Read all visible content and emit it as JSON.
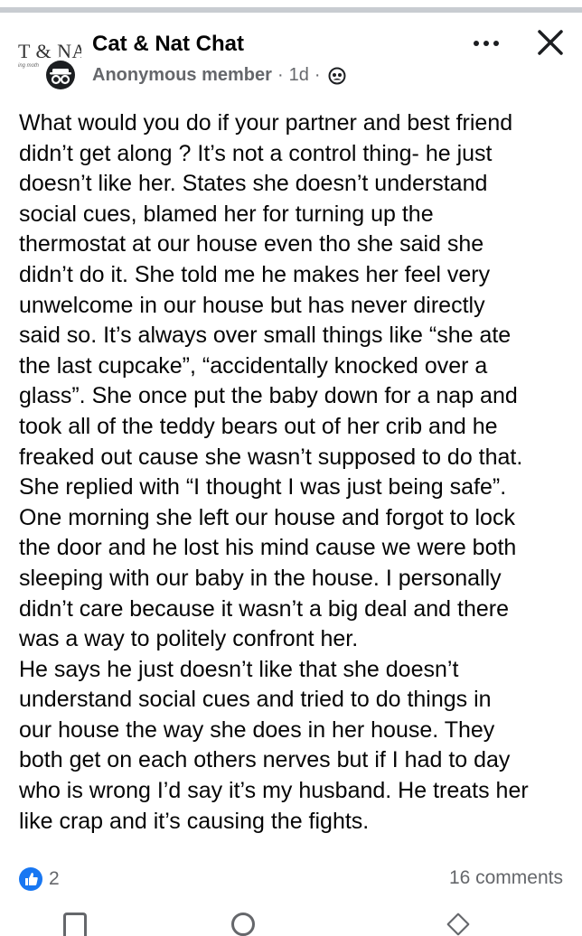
{
  "header": {
    "group_logo_text": "T & NAT C",
    "group_logo_sub": "ing moth",
    "group_name": "Cat & Nat Chat",
    "author": "Anonymous member",
    "separator": "·",
    "time": "1d",
    "separator2": "·",
    "privacy_icon": "group-privacy-icon",
    "more_icon": "more-horizontal-icon",
    "close_icon": "close-icon"
  },
  "post": {
    "text": "What would you do if your partner and best friend\ndidn’t get along ?  It’s not a control thing- he just\ndoesn’t like her. States she doesn’t understand\nsocial cues, blamed her for turning up the\nthermostat at our house even tho she said she\ndidn’t do it.  She told me he makes her feel very\nunwelcome in our house but has never directly\nsaid so. It’s always over small things like “she ate\nthe last cupcake”, “accidentally knocked over a\nglass”. She once put the baby down for a nap and\ntook all of the teddy bears out of her crib and he\nfreaked out cause she wasn’t supposed to do that.\nShe replied with “I thought I was just being safe”.\nOne morning she left our house and forgot to lock\nthe door and he lost his mind cause we were both\nsleeping with our baby in the house. I personally\ndidn’t care because it wasn’t a big deal and there\nwas a way to politely confront her.\nHe says he just doesn’t like that she doesn’t\nunderstand social cues and tried to do things in\nour house the way she does in her house.  They\nboth get on each others nerves but if I  had to day\nwho is wrong I’d say it’s my husband. He treats her\nlike crap and it’s causing the fights."
  },
  "footer": {
    "like_icon": "like-thumb-icon",
    "like_count": "2",
    "comments": "16 comments"
  },
  "colors": {
    "like_blue": "#1877f2",
    "meta_gray": "#65676b",
    "text": "#050505"
  }
}
